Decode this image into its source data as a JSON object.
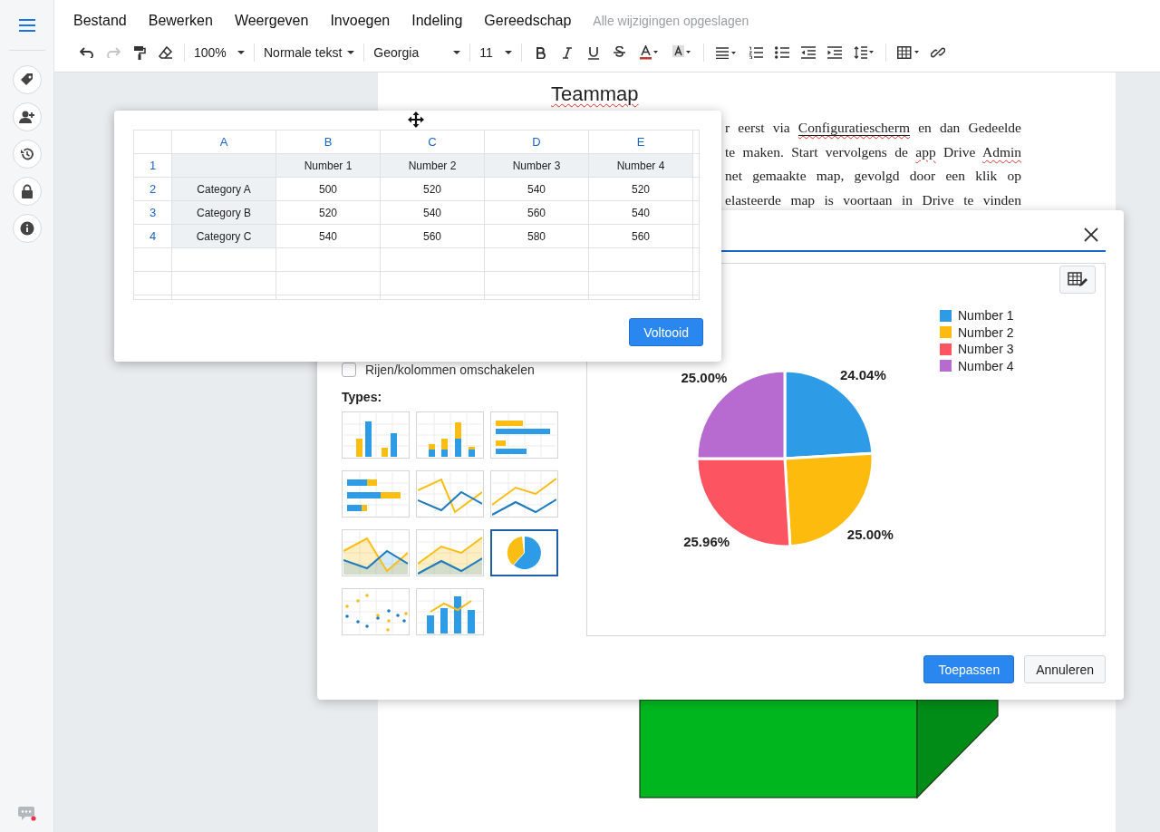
{
  "menu": [
    "Bestand",
    "Bewerken",
    "Weergeven",
    "Invoegen",
    "Indeling",
    "Gereedschap"
  ],
  "save_status": "Alle wijzigingen opgeslagen",
  "toolbar": {
    "zoom": "100%",
    "style": "Normale tekst",
    "font": "Georgia",
    "size": "11",
    "redo": {
      "disabled": true
    }
  },
  "sidebar": {
    "chat": {
      "notification": true
    }
  },
  "document": {
    "title": {
      "text": "Teammap",
      "misspelled": true
    },
    "lines": [
      [
        {
          "text": "r eerst via ",
          "kind": "plain"
        },
        {
          "text": "Configuratiescherm",
          "kind": "underlined-misspelled"
        },
        {
          "text": " en dan Gedeelde",
          "kind": "plain"
        }
      ],
      [
        {
          "text": "te maken. Start vervolgens de ",
          "kind": "plain"
        },
        {
          "text": "app",
          "kind": "misspelled"
        },
        {
          "text": " Drive ",
          "kind": "plain"
        },
        {
          "text": "Admin",
          "kind": "misspelled"
        }
      ],
      [
        {
          "text": "net gemaakte map, gevolgd door een klik op",
          "kind": "plain"
        }
      ],
      [
        {
          "text": "elasteerde map is voortaan in Drive te vinden",
          "kind": "plain"
        }
      ]
    ]
  },
  "data_editor": {
    "columns": [
      "A",
      "B",
      "C",
      "D",
      "E"
    ],
    "rows": [
      {
        "label": "1",
        "values": [
          "Number 1",
          "Number 2",
          "Number 3",
          "Number 4"
        ]
      },
      {
        "label": "2",
        "category": "Category A",
        "values": [
          "500",
          "520",
          "540",
          "520"
        ]
      },
      {
        "label": "3",
        "category": "Category B",
        "values": [
          "520",
          "540",
          "560",
          "540"
        ]
      },
      {
        "label": "4",
        "category": "Category C",
        "values": [
          "540",
          "560",
          "580",
          "560"
        ]
      }
    ],
    "done_button": "Voltooid"
  },
  "chart_editor": {
    "switch_rows_columns": {
      "label": "Rijen/kolommen omschakelen",
      "checked": false
    },
    "types_label": "Types:",
    "chart_types": [
      {
        "kind": "column",
        "selected": false
      },
      {
        "kind": "stacked",
        "selected": false
      },
      {
        "kind": "bar",
        "selected": false
      },
      {
        "kind": "stackedbar",
        "selected": false
      },
      {
        "kind": "line",
        "selected": false
      },
      {
        "kind": "trend",
        "selected": false
      },
      {
        "kind": "area",
        "selected": false
      },
      {
        "kind": "trendarea",
        "selected": false
      },
      {
        "kind": "pie",
        "selected": true
      },
      {
        "kind": "scatter",
        "selected": false
      },
      {
        "kind": "combo",
        "selected": false
      }
    ],
    "preview": {
      "legend": [
        {
          "color": "#2d9be6"
        },
        {
          "color": "#fdbb0e"
        },
        {
          "color": "#fd5461"
        },
        {
          "color": "#b76ad0"
        }
      ],
      "chart_data": {
        "type": "pie",
        "categories": [
          "Number 1",
          "Number 2",
          "Number 3",
          "Number 4"
        ],
        "series": [
          {
            "values": [
              24.04,
              25.0,
              25.96,
              25.0
            ]
          }
        ],
        "value_labels": [
          "24.04%",
          "25.00%",
          "25.96%",
          "25.00%"
        ]
      }
    },
    "buttons": {
      "apply": "Toepassen",
      "cancel": "Annuleren"
    }
  }
}
